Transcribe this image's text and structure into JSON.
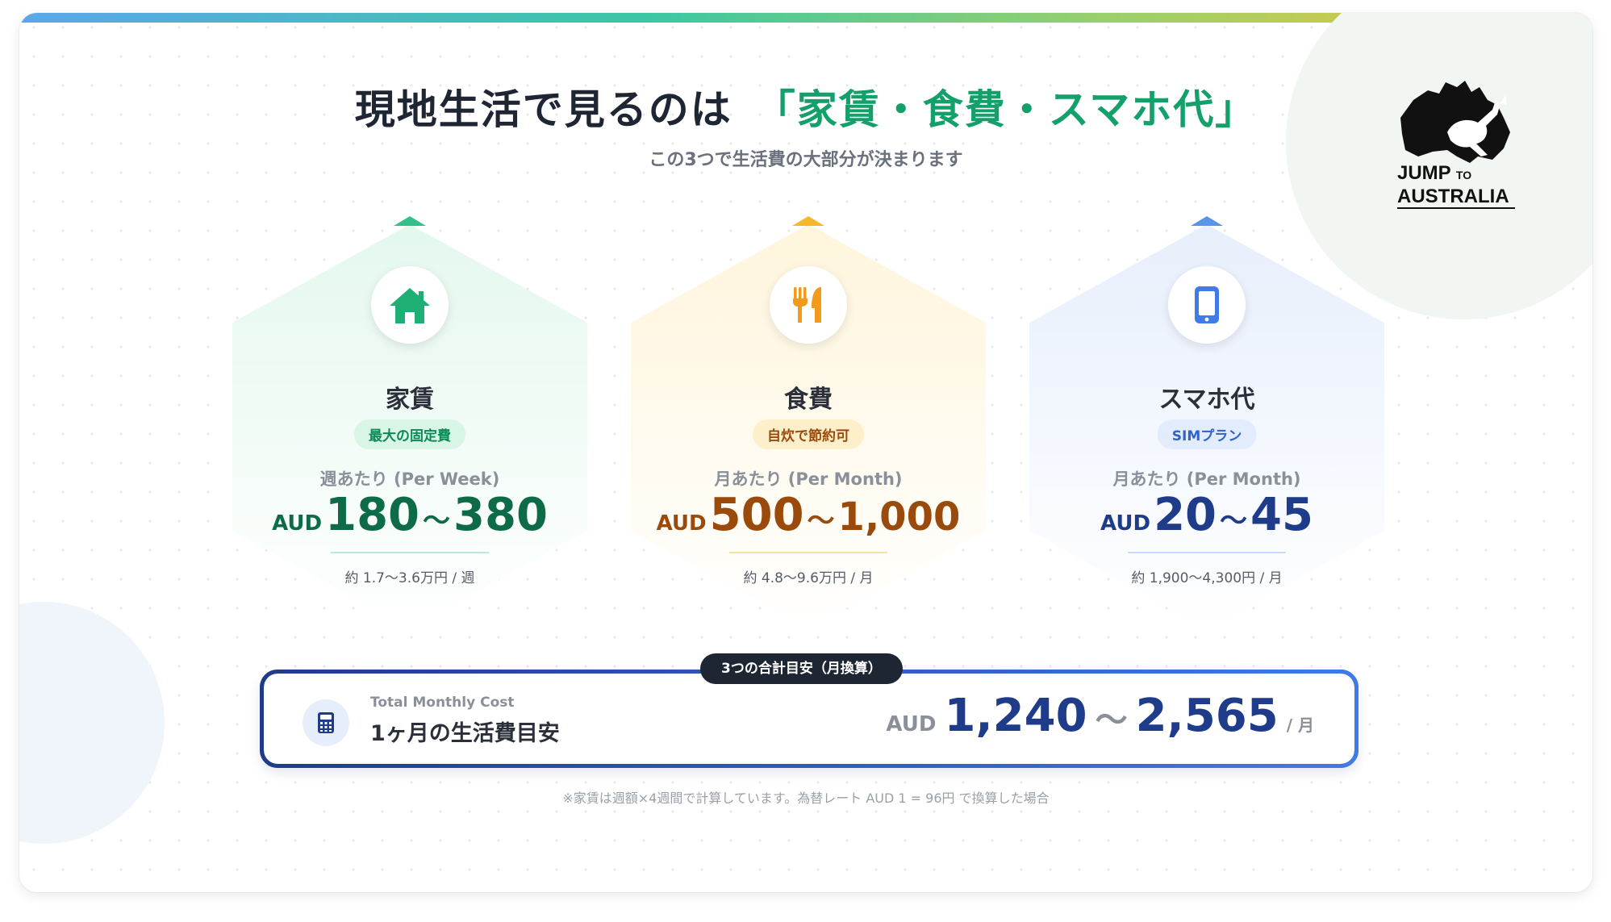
{
  "title": {
    "main": "現地生活で見るのは",
    "highlight": "「家賃・食費・スマホ代」"
  },
  "subtitle": "この3つで生活費の大部分が決まります",
  "logo": {
    "line1": "JUMP",
    "line1_small": "TO",
    "line2": "AUSTRALIA"
  },
  "cards": [
    {
      "icon": "house-icon",
      "name": "家賃",
      "badge": "最大の固定費",
      "period": "週あたり (Per Week)",
      "currency": "AUD",
      "min": "180",
      "tilde": "～",
      "max": "380",
      "yen": "約 1.7〜3.6万円 / 週",
      "colors": {
        "accent": "#0e6b48",
        "badge_bg": "#d8f5e6",
        "badge_text": "#0e8a57",
        "tint": "#eafaf2",
        "cap": "#34c08a",
        "icon": "#1fae73"
      }
    },
    {
      "icon": "fork-knife-icon",
      "name": "食費",
      "badge": "自炊で節約可",
      "period": "月あたり (Per Month)",
      "currency": "AUD",
      "min": "500",
      "tilde": "～",
      "max": "1,000",
      "yen": "約 4.8〜9.6万円 / 月",
      "colors": {
        "accent": "#9a4a0a",
        "badge_bg": "#fdefc9",
        "badge_text": "#9a4a0a",
        "tint": "#fff8e6",
        "cap": "#f5b82a",
        "icon": "#f39a1a"
      }
    },
    {
      "icon": "smartphone-icon",
      "name": "スマホ代",
      "badge": "SIMプラン",
      "period": "月あたり (Per Month)",
      "currency": "AUD",
      "min": "20",
      "tilde": "～",
      "max": "45",
      "yen": "約 1,900〜4,300円 / 月",
      "colors": {
        "accent": "#1f3c8a",
        "badge_bg": "#e2ecfc",
        "badge_text": "#2f63c9",
        "tint": "#eef4fd",
        "cap": "#5a95ea",
        "icon": "#3f7be6"
      }
    }
  ],
  "total": {
    "tab_label": "3つの合計目安（月換算）",
    "label_en": "Total Monthly Cost",
    "label_jp": "1ヶ月の生活費目安",
    "currency": "AUD",
    "min": "1,240",
    "tilde": "～",
    "max": "2,565",
    "unit": "/ 月"
  },
  "footnote": "※家賃は週額×4週間で計算しています。為替レート AUD 1 = 96円 で換算した場合"
}
